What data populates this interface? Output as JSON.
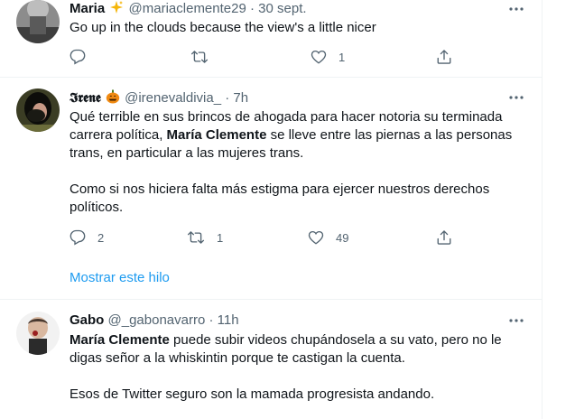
{
  "tweets": [
    {
      "name": "Maria",
      "handle": "@mariaclemente29",
      "sep": "·",
      "time": "30 sept.",
      "text": "Go up in the clouds because the view's a little nicer",
      "replies": "",
      "retweets": "",
      "likes": "1"
    },
    {
      "name": "𝕴𝖗𝖊𝖓𝖊",
      "handle": "@irenevaldivia_",
      "sep": "·",
      "time": "7h",
      "text_p1_a": "Qué terrible en sus brincos de ahogada para hacer notoria su terminada carrera política, ",
      "text_p1_bold": "María Clemente",
      "text_p1_b": " se lleve entre las piernas a las personas trans, en particular a las mujeres trans.",
      "text_p2": "Como si nos hiciera falta más estigma para ejercer nuestros derechos políticos.",
      "replies": "2",
      "retweets": "1",
      "likes": "49"
    },
    {
      "name": "Gabo",
      "handle": "@_gabonavarro",
      "sep": "·",
      "time": "11h",
      "text_p1_bold": "María Clemente",
      "text_p1_b": " puede subir videos chupándosela a su vato, pero no le digas señor a la whiskintin porque te castigan la cuenta.",
      "text_p2": "Esos de Twitter seguro son la mamada progresista andando."
    }
  ],
  "show_thread": "Mostrar este hilo",
  "icons": {
    "reply": "reply-icon",
    "retweet": "retweet-icon",
    "like": "heart-icon",
    "share": "share-icon",
    "more": "more-icon",
    "sparkles": "sparkles-icon",
    "pumpkin": "jack-o-lantern-icon"
  },
  "colors": {
    "text": "#0f1419",
    "secondary": "#536471",
    "link": "#1d9bf0",
    "border": "#eff3f4"
  }
}
